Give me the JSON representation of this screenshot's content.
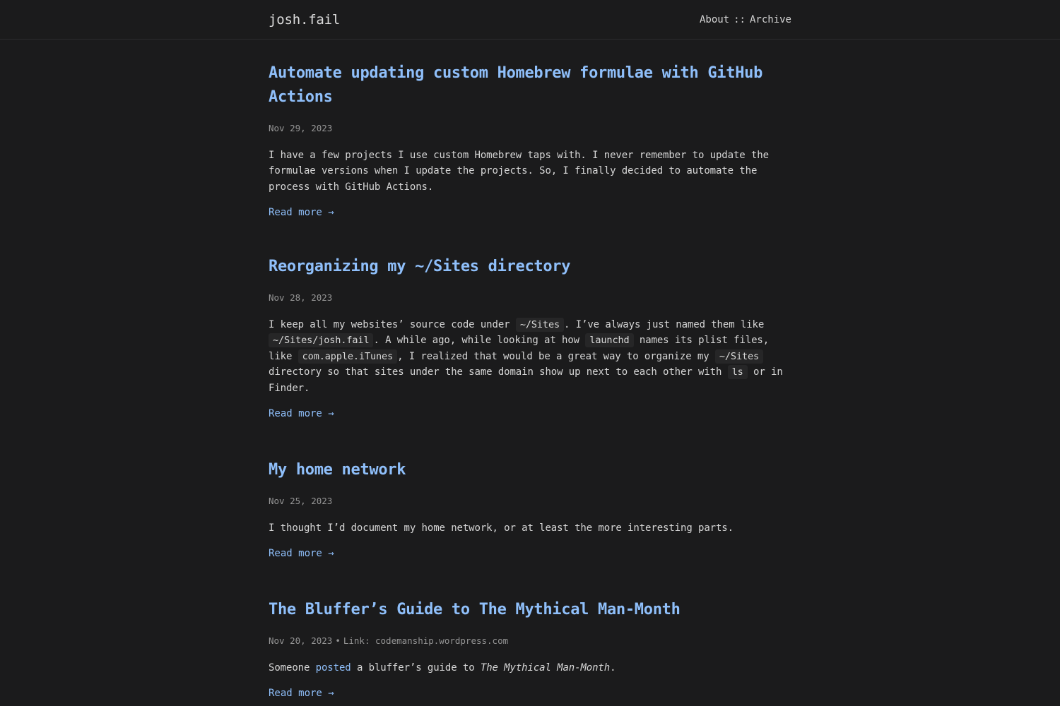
{
  "header": {
    "site_title": "josh.fail",
    "nav": {
      "about": "About",
      "separator": "::",
      "archive": "Archive"
    }
  },
  "colors": {
    "background": "#1b1b1c",
    "accent_link": "#8fbffa",
    "text": "#d6d6d6",
    "meta": "#959595"
  },
  "posts": [
    {
      "title": "Automate updating custom Homebrew formulae with GitHub Actions",
      "date": "Nov 29, 2023",
      "excerpt": "I have a few projects I use custom Homebrew taps with. I never remember to update the formulae versions when I update the projects. So, I finally decided to automate the process with GitHub Actions.",
      "read_more": "Read more →"
    },
    {
      "title": "Reorganizing my ~/Sites directory",
      "date": "Nov 28, 2023",
      "excerpt_parts": [
        "I keep all my websites’ source code under ",
        "~/Sites",
        ". I’ve always just named them like ",
        "~/Sites/josh.fail",
        ". A while ago, while looking at how ",
        "launchd",
        " names its plist files, like ",
        "com.apple.iTunes",
        ", I realized that would be a great way to organize my ",
        "~/Sites",
        " directory so that sites under the same domain show up next to each other with ",
        "ls",
        " or in Finder."
      ],
      "read_more": "Read more →"
    },
    {
      "title": "My home network",
      "date": "Nov 25, 2023",
      "excerpt": "I thought I’d document my home network, or at least the more interesting parts.",
      "read_more": "Read more →"
    },
    {
      "title": "The Bluffer’s Guide to The Mythical Man-Month",
      "date": "Nov 20, 2023",
      "bullet": "•",
      "link_label": "Link: codemanship.wordpress.com",
      "excerpt_parts": [
        "Someone ",
        "posted",
        " a bluffer’s guide to ",
        "The Mythical Man-Month",
        "."
      ],
      "read_more": "Read more →"
    }
  ]
}
